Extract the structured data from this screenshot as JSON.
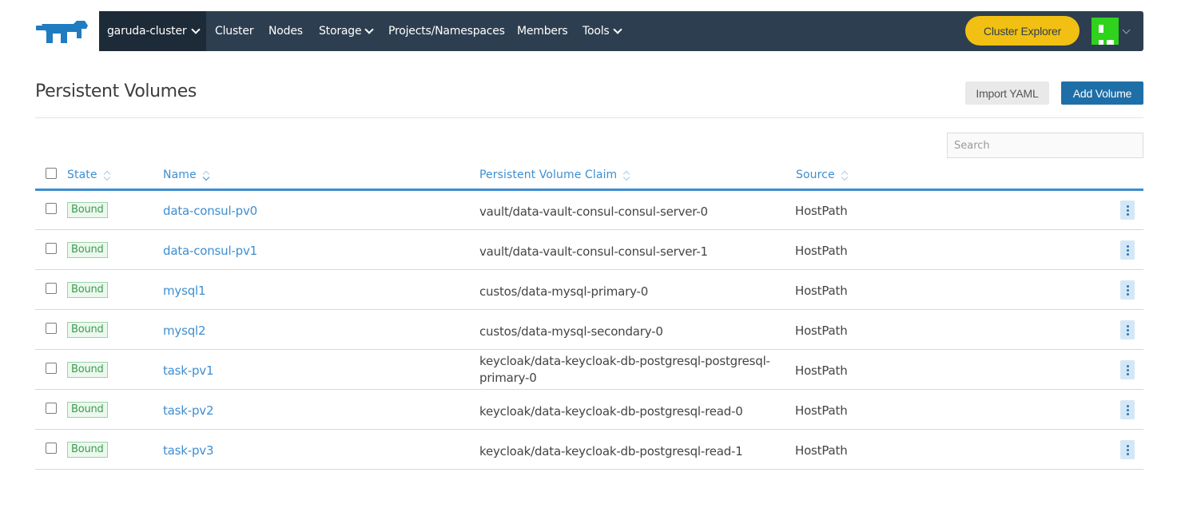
{
  "nav": {
    "cluster": "garuda-cluster",
    "items": [
      {
        "label": "Cluster",
        "dropdown": false
      },
      {
        "label": "Nodes",
        "dropdown": false
      },
      {
        "label": "Storage",
        "dropdown": true
      },
      {
        "label": "Projects/Namespaces",
        "dropdown": false
      },
      {
        "label": "Members",
        "dropdown": false
      },
      {
        "label": "Tools",
        "dropdown": true
      }
    ],
    "explorer_label": "Cluster Explorer"
  },
  "page": {
    "title": "Persistent Volumes",
    "import_label": "Import YAML",
    "add_label": "Add Volume"
  },
  "search": {
    "placeholder": "Search"
  },
  "table": {
    "headers": [
      "State",
      "Name",
      "Persistent Volume Claim",
      "Source"
    ],
    "rows": [
      {
        "state": "Bound",
        "name": "data-consul-pv0",
        "claim": "vault/data-vault-consul-consul-server-0",
        "source": "HostPath"
      },
      {
        "state": "Bound",
        "name": "data-consul-pv1",
        "claim": "vault/data-vault-consul-consul-server-1",
        "source": "HostPath"
      },
      {
        "state": "Bound",
        "name": "mysql1",
        "claim": "custos/data-mysql-primary-0",
        "source": "HostPath"
      },
      {
        "state": "Bound",
        "name": "mysql2",
        "claim": "custos/data-mysql-secondary-0",
        "source": "HostPath"
      },
      {
        "state": "Bound",
        "name": "task-pv1",
        "claim": "keycloak/data-keycloak-db-postgresql-postgresql-primary-0",
        "source": "HostPath"
      },
      {
        "state": "Bound",
        "name": "task-pv2",
        "claim": "keycloak/data-keycloak-db-postgresql-read-0",
        "source": "HostPath"
      },
      {
        "state": "Bound",
        "name": "task-pv3",
        "claim": "keycloak/data-keycloak-db-postgresql-read-1",
        "source": "HostPath"
      }
    ]
  },
  "colors": {
    "navbar": "#2d3e50",
    "accent": "#3d8ed1",
    "primary_button": "#1e6fa7",
    "explorer_button": "#f2c012",
    "bound_badge": "#3b9d4f"
  },
  "icons": {
    "logo": "rancher-logo-icon",
    "dropdown": "chevron-down-icon",
    "sort": "sort-icon",
    "row_actions": "kebab-menu-icon"
  }
}
